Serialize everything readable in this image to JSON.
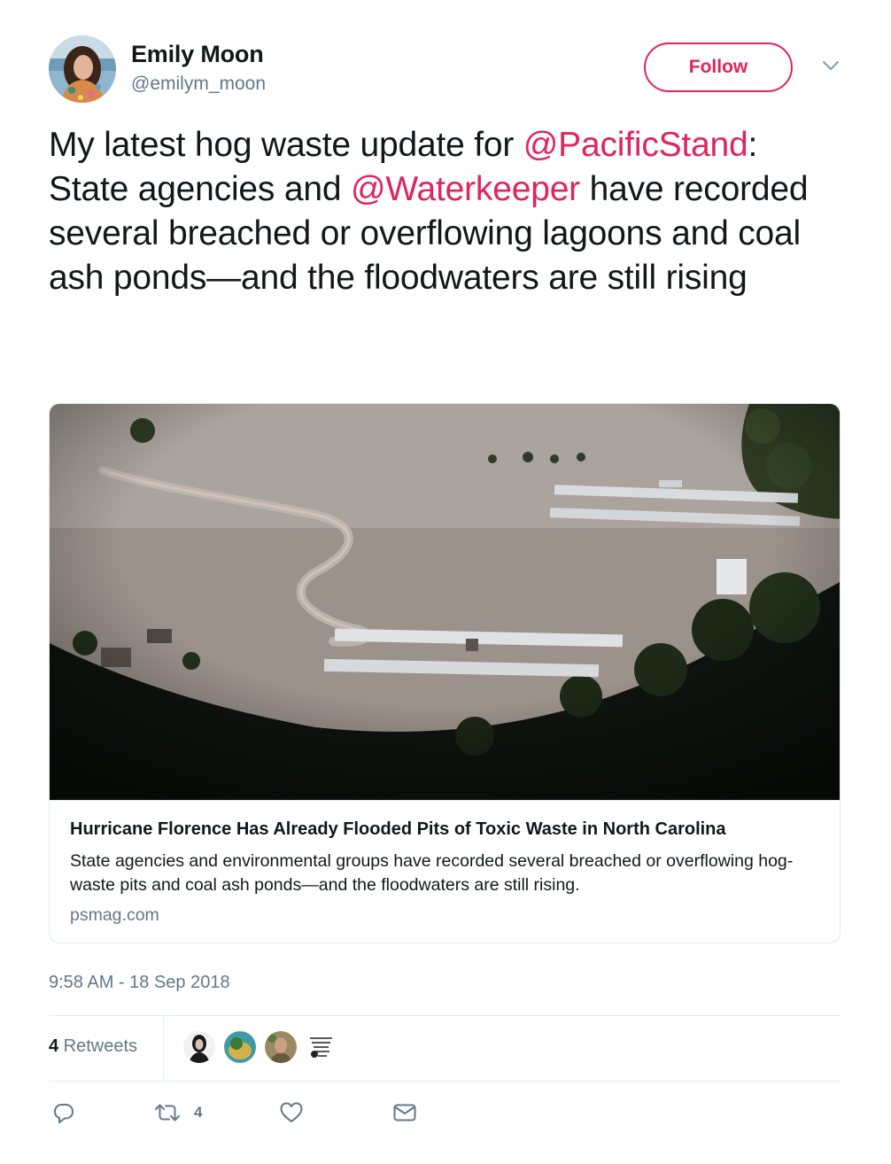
{
  "author": {
    "name": "Emily Moon",
    "handle": "@emilym_moon"
  },
  "follow_label": "Follow",
  "tweet": {
    "part1": "My latest hog waste update for ",
    "mention1": "@PacificStand",
    "part2": ": State agencies and ",
    "mention2": "@Waterkeeper",
    "part3": " have recorded several breached or overflowing lagoons and coal ash ponds—and the floodwaters are still rising"
  },
  "card": {
    "title": "Hurricane Florence Has Already Flooded Pits of Toxic Waste in North Carolina",
    "description": "State agencies and environmental groups have recorded several breached or overflowing hog-waste pits and coal ash ponds—and the floodwaters are still rising.",
    "domain": "psmag.com"
  },
  "timestamp": "9:58 AM - 18 Sep 2018",
  "stats": {
    "retweet_count": "4",
    "retweet_label": " Retweets"
  },
  "actions": {
    "retweet_count": "4"
  },
  "icons": {
    "more": "chevron-down-icon",
    "reply": "reply-icon",
    "retweet": "retweet-icon",
    "like": "heart-icon",
    "message": "envelope-icon"
  },
  "colors": {
    "accent": "#e0245e",
    "secondary_text": "#657786",
    "primary_text": "#14171a",
    "border": "#e1e8ed"
  }
}
